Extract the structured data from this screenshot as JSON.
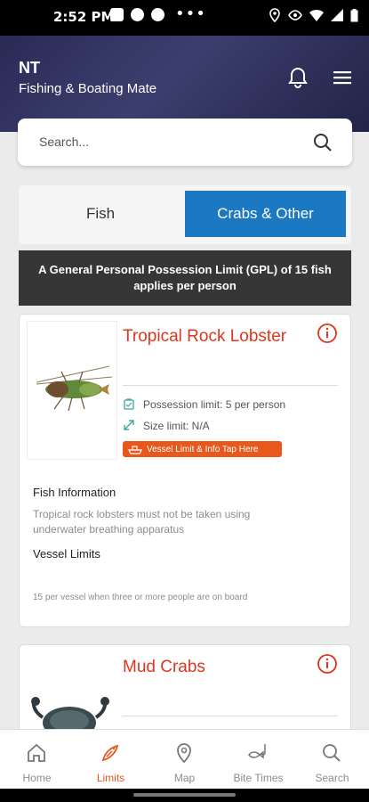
{
  "status_bar": {
    "time": "2:52 PM"
  },
  "header": {
    "title": "NT",
    "subtitle": "Fishing & Boating Mate"
  },
  "search": {
    "placeholder": "Search..."
  },
  "tabs": [
    {
      "label": "Fish"
    },
    {
      "label": "Crabs & Other"
    }
  ],
  "banner": {
    "text": "A General Personal Possession Limit (GPL) of 15 fish applies per person"
  },
  "cards": [
    {
      "title": "Tropical Rock Lobster",
      "possession_limit": "Possession limit: 5 per person",
      "size_limit": "Size limit: N/A",
      "vessel_button": "Vessel Limit & Info Tap Here",
      "fish_info_label": "Fish Information",
      "fish_info_text": "Tropical rock lobsters must not be taken using underwater breathing apparatus",
      "vessel_limits_label": "Vessel Limits",
      "vessel_limits_text": "15 per vessel when three or more people are on board"
    },
    {
      "title": "Mud Crabs"
    }
  ],
  "nav": {
    "items": [
      {
        "label": "Home",
        "icon": "home-icon"
      },
      {
        "label": "Limits",
        "icon": "limits-fish-icon",
        "active": true
      },
      {
        "label": "Map",
        "icon": "map-pin-icon"
      },
      {
        "label": "Bite Times",
        "icon": "fish-hook-icon"
      },
      {
        "label": "Search",
        "icon": "search-icon"
      }
    ]
  },
  "colors": {
    "accent": "#e0361b",
    "tab_active": "#1b78c1",
    "header_bg": "#2d2f58",
    "vessel_button": "#e8581d"
  }
}
